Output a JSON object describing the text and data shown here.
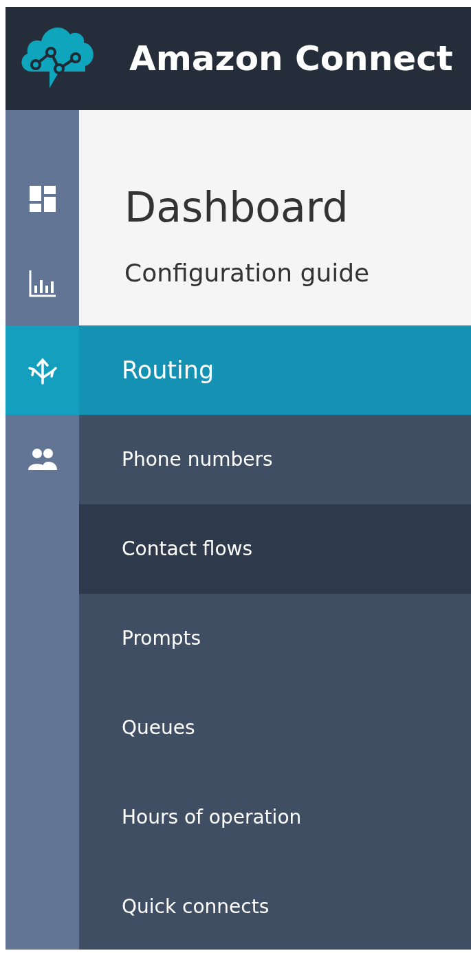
{
  "header": {
    "title": "Amazon Connect"
  },
  "rail": [
    {
      "kind": "dashboard",
      "selected": false
    },
    {
      "kind": "metrics",
      "selected": false
    },
    {
      "kind": "routing",
      "selected": true
    },
    {
      "kind": "users",
      "selected": false
    }
  ],
  "page": {
    "heading": "Dashboard",
    "section": "Configuration guide"
  },
  "flyout": {
    "title": "Routing",
    "items": [
      {
        "label": "Phone numbers",
        "selected": false
      },
      {
        "label": "Contact flows",
        "selected": true
      },
      {
        "label": "Prompts",
        "selected": false
      },
      {
        "label": "Queues",
        "selected": false
      },
      {
        "label": "Hours of operation",
        "selected": false
      },
      {
        "label": "Quick connects",
        "selected": false
      }
    ]
  }
}
